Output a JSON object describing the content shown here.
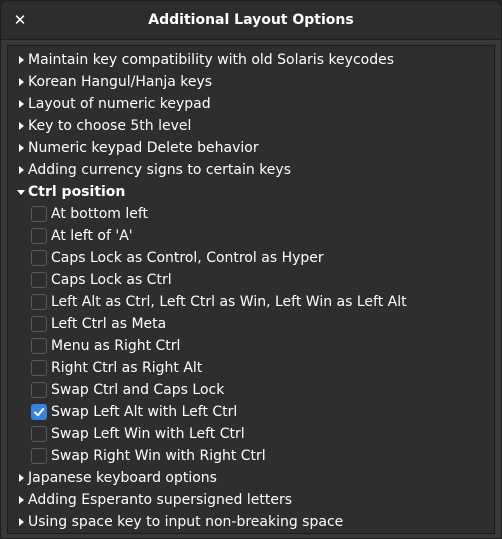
{
  "window": {
    "title": "Additional Layout Options",
    "close_icon": "close-icon"
  },
  "colors": {
    "accent": "#3584e4",
    "background": "#2e2e2e",
    "titlebar": "#2d2d2d"
  },
  "groups_before": [
    {
      "label": "Maintain key compatibility with old Solaris keycodes",
      "expanded": false
    },
    {
      "label": "Korean Hangul/Hanja keys",
      "expanded": false
    },
    {
      "label": "Layout of numeric keypad",
      "expanded": false
    },
    {
      "label": "Key to choose 5th level",
      "expanded": false
    },
    {
      "label": "Numeric keypad Delete behavior",
      "expanded": false
    },
    {
      "label": "Adding currency signs to certain keys",
      "expanded": false
    }
  ],
  "expanded_group": {
    "label": "Ctrl position",
    "expanded": true,
    "options": [
      {
        "label": "At bottom left",
        "checked": false
      },
      {
        "label": "At left of 'A'",
        "checked": false
      },
      {
        "label": "Caps Lock as Control, Control as Hyper",
        "checked": false
      },
      {
        "label": "Caps Lock as Ctrl",
        "checked": false
      },
      {
        "label": "Left Alt as Ctrl, Left Ctrl as Win, Left Win as Left Alt",
        "checked": false
      },
      {
        "label": "Left Ctrl as Meta",
        "checked": false
      },
      {
        "label": "Menu as Right Ctrl",
        "checked": false
      },
      {
        "label": "Right Ctrl as Right Alt",
        "checked": false
      },
      {
        "label": "Swap Ctrl and Caps Lock",
        "checked": false
      },
      {
        "label": "Swap Left Alt with Left Ctrl",
        "checked": true
      },
      {
        "label": "Swap Left Win with Left Ctrl",
        "checked": false
      },
      {
        "label": "Swap Right Win with Right Ctrl",
        "checked": false
      }
    ]
  },
  "groups_after": [
    {
      "label": "Japanese keyboard options",
      "expanded": false
    },
    {
      "label": "Adding Esperanto supersigned letters",
      "expanded": false
    },
    {
      "label": "Using space key to input non-breaking space",
      "expanded": false
    }
  ]
}
